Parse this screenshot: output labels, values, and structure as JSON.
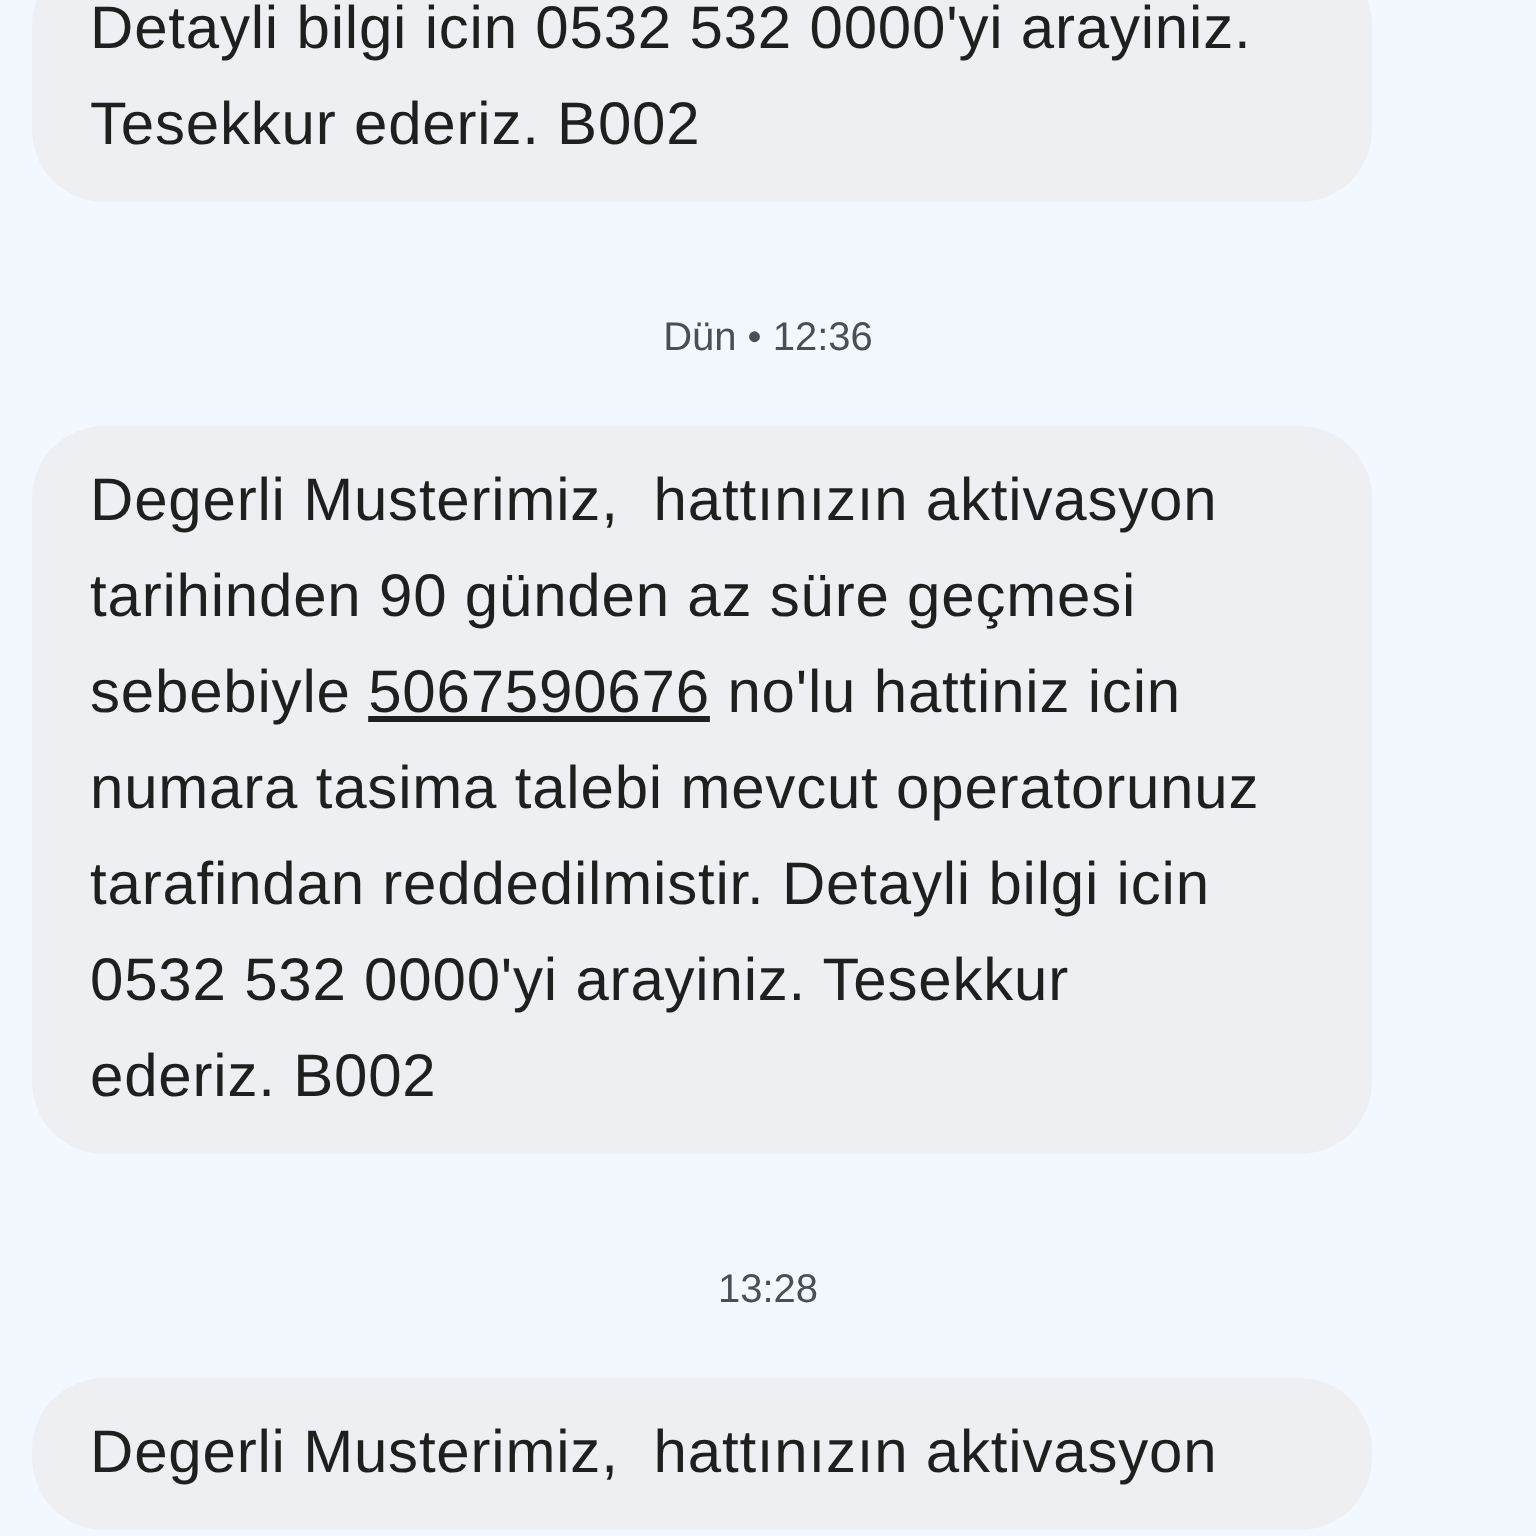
{
  "conversation": [
    {
      "kind": "message",
      "parts": [
        {
          "kind": "text",
          "text": "Detayli bilgi icin 0532 532 0000'yi arayiniz. Tesekkur ederiz. B002"
        }
      ]
    },
    {
      "kind": "timestamp",
      "text": "Dün • 12:36"
    },
    {
      "kind": "message",
      "parts": [
        {
          "kind": "text",
          "text": "Degerli Musterimiz,  hattınızın aktivasyon tarihinden 90 günden az süre geçmesi sebebiyle "
        },
        {
          "kind": "link",
          "text": "5067590676"
        },
        {
          "kind": "text",
          "text": " no'lu hattiniz icin numara tasima talebi mevcut operatorunuz tarafindan reddedilmistir. Detayli bilgi icin 0532 532 0000'yi arayiniz. Tesekkur ederiz. B002"
        }
      ]
    },
    {
      "kind": "timestamp",
      "text": "13:28"
    },
    {
      "kind": "message",
      "parts": [
        {
          "kind": "text",
          "text": "Degerli Musterimiz,  hattınızın aktivasyon"
        }
      ]
    }
  ]
}
